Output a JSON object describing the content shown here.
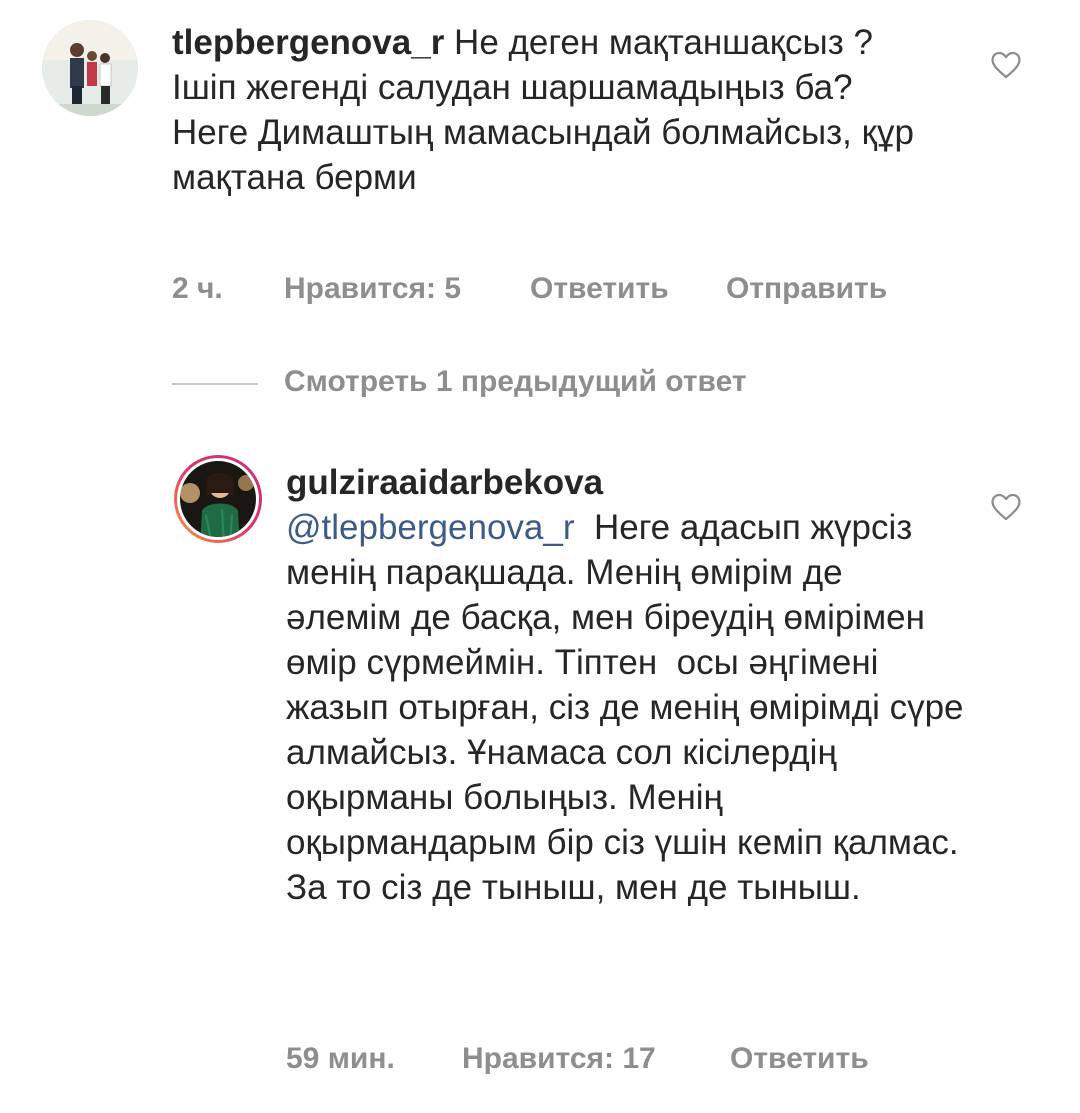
{
  "comments": [
    {
      "username": "tlepbergenova_r",
      "text": " Не деген мақтаншақсыз ? Ішіп жегенді салудан шаршамадыңыз ба? Неге Димаштың мамасындай болмайсыз, құр мақтана берми",
      "time": "2 ч.",
      "likes": "Нравится: 5",
      "reply": "Ответить",
      "send": "Отправить",
      "icon": "heart-outline-icon"
    },
    {
      "username": "gulziraaidarbekova",
      "mention": "@tlepbergenova_r",
      "text": "  Неге адасып жүрсіз менің парақшада. Менің өмірім де әлемім де басқа, мен біреудің өмірімен өмір сүрмеймін. Тіптен  осы әңгімені жазып отырған, сіз де менің өмірімді сүре алмайсыз. Ұнамаса сол кісілердің оқырманы болыңыз. Менің оқырмандарым бір сіз үшін кеміп қалмас. За то сіз де тыныш, мен де тыныш.",
      "time": "59 мин.",
      "likes": "Нравится: 17",
      "reply": "Ответить",
      "icon": "heart-outline-icon",
      "story_ring": true
    }
  ],
  "view_previous_replies": "Смотреть 1 предыдущий ответ",
  "colors": {
    "text": "#262626",
    "meta": "#8e8e8e",
    "mention": "#3b5c8a",
    "divider": "#c7c7c7"
  }
}
